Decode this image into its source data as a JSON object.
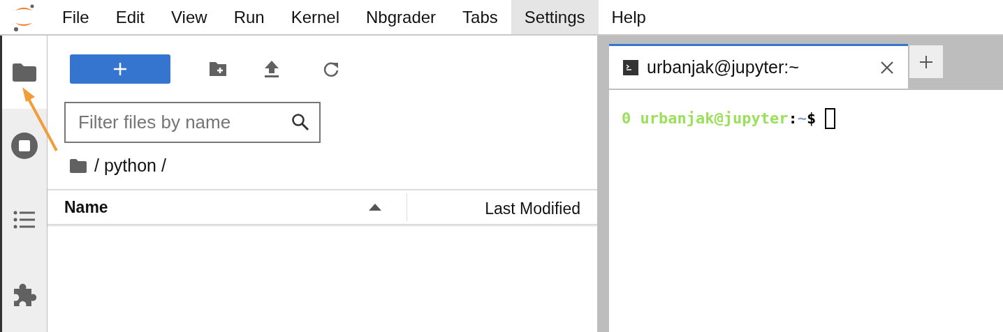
{
  "menu": [
    {
      "label": "File",
      "selected": false
    },
    {
      "label": "Edit",
      "selected": false
    },
    {
      "label": "View",
      "selected": false
    },
    {
      "label": "Run",
      "selected": false
    },
    {
      "label": "Kernel",
      "selected": false
    },
    {
      "label": "Nbgrader",
      "selected": false
    },
    {
      "label": "Tabs",
      "selected": false
    },
    {
      "label": "Settings",
      "selected": true
    },
    {
      "label": "Help",
      "selected": false
    }
  ],
  "sidebar": {
    "items": [
      {
        "kind": "folder",
        "selected": true
      },
      {
        "kind": "running",
        "selected": false
      },
      {
        "kind": "toc",
        "selected": false
      },
      {
        "kind": "extensions",
        "selected": false
      }
    ]
  },
  "file_browser": {
    "filter": {
      "placeholder": "Filter files by name"
    },
    "breadcrumb": "/ python /",
    "columns": [
      {
        "label": "Name",
        "sorted": true
      },
      {
        "label": "Last Modified",
        "sorted": false
      }
    ]
  },
  "terminal": {
    "tabs": [
      {
        "title": "urbanjak@jupyter:~",
        "selected": true
      }
    ],
    "prompt": [
      {
        "text": "0 urbanjak@jupyter",
        "color": "#9be05a"
      },
      {
        "text": ":",
        "color": "#000000"
      },
      {
        "text": "~",
        "color": "#7b9fd6"
      },
      {
        "text": "$",
        "color": "#000000"
      }
    ]
  }
}
